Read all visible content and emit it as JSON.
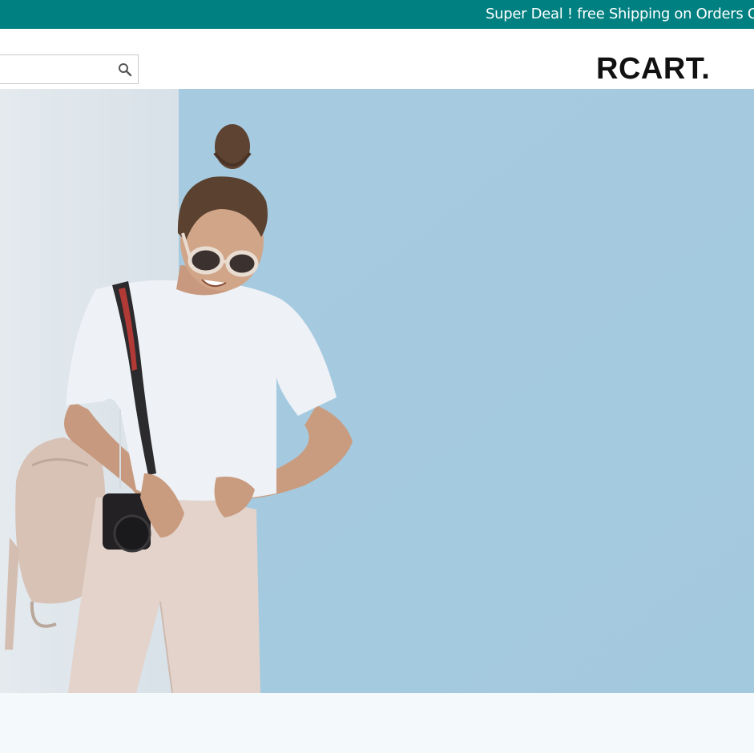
{
  "promo": {
    "text": "Super Deal ! free Shipping on Orders O"
  },
  "header": {
    "search": {
      "placeholder": "",
      "value": "",
      "icon": "search-icon"
    },
    "logo": "RCART."
  },
  "hero": {
    "image": "woman-with-camera-photo",
    "colors": {
      "wall_left": "#dfe6ec",
      "wall_right": "#a9cde2"
    }
  },
  "colors": {
    "accent": "#008080",
    "text_on_accent": "#ffffff",
    "logo": "#111111",
    "page_bg": "#f4f9fb"
  }
}
